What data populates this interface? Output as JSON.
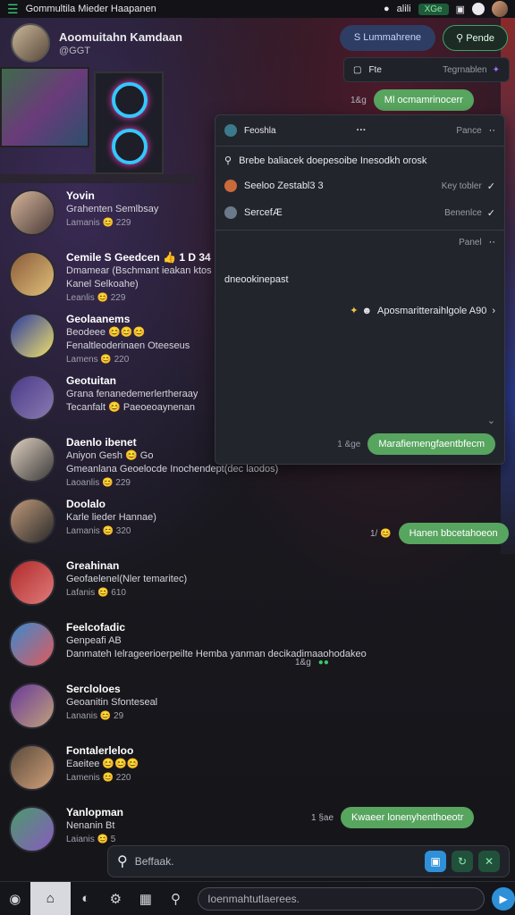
{
  "statusbar": {
    "title": "Gommultila Mieder Haapanen",
    "pill": "XGe",
    "label_a": "alili"
  },
  "header": {
    "community_name": "Aoomuitahn Kamdaan",
    "community_sub": "@GGT",
    "btn_primary": "S  Lummahrene",
    "btn_secondary": "Pende"
  },
  "top_chat": {
    "label": "Fte",
    "meta": "Tegrnablen",
    "bubble": "Ml ocmamrinocerr",
    "time": "1&g"
  },
  "panel": {
    "title": "Feoshla",
    "title_right": "Pance",
    "line1": "Brebe baliacek doepesoibe Inesodkh orosk",
    "item1": "Seeloo Zestabl3 3",
    "item1_right": "Key tobler",
    "item2": "SercefÆ",
    "item2_right": "Benenlce",
    "section_right": "Panel",
    "label": "dneookinepast",
    "link": "Aposmaritteraihlgole A90",
    "bubble": "Marafiemengfaentbfecm",
    "bubble_time": "1 &ge"
  },
  "contacts": [
    {
      "name": "Yovin",
      "line": "Grahenten Semlbsay",
      "time": "Lamanis  😊 229"
    },
    {
      "name": "Cemile S Geedcen  👍 1 D 34",
      "line": "Dmamear (Bschmant ieakan ktos",
      "line2": "Kanel Selkoahe)",
      "time": "Leanlis  😊 229"
    },
    {
      "name": "Geolaanems",
      "line": "Beodeee  😊😊😊",
      "line2": "Fenaltleoderinaen Oteeseus",
      "time": "Lamens  😊 220"
    },
    {
      "name": "Geotuitan",
      "line": "Grana  fenanedemerlertheraay",
      "line2": "Tecanfalt  😊 Paeoeoaynenan",
      "time": ""
    },
    {
      "name": "Daenlo ibenet",
      "line": "Aniyon Gesh  😊  Go",
      "line2": "Gmeanlana Geoelocde Inochendept(dec laodos)",
      "time": "Laoanlis  😊 229"
    },
    {
      "name": "Doolalo",
      "line": "Karle  lieder Hannae)",
      "time": "Lamanis  😊 320"
    },
    {
      "name": "Greahinan",
      "line": "Geofaelenel(Nler temaritec)",
      "time": "Lafanis  😊 610"
    },
    {
      "name": "Feelcofadic",
      "line": "Genpeafi  AB",
      "line2": "Danmateh Ielrageerioerpeilte Hemba yanman decikadimaaohodakeo",
      "time": ""
    },
    {
      "name": "Sercloloes",
      "line": "Geoanitin  Sfonteseal",
      "time": "Lananis  😊 29"
    },
    {
      "name": "Fontalerleloo",
      "line": "Eaeitee  😊😊😊",
      "time": "Lamenis  😊 220"
    },
    {
      "name": "Yanlopman",
      "line": "Nenanin  Bt",
      "time": "Laianis  😊 5"
    }
  ],
  "chat_items": [
    {
      "time": "1/ 😊",
      "bubble": "Hanen bbcetahoeon"
    },
    {
      "time": "1&g",
      "bubble": ""
    },
    {
      "time": "1 §ae",
      "bubble": "Kwaeer lonenyhenthoeotr"
    }
  ],
  "search": {
    "placeholder": "Beffaak."
  },
  "bottom": {
    "input_placeholder": "Ioenmahtutlaerees."
  },
  "colors": {
    "accent_green": "#57a55f",
    "accent_blue": "#2e90d9",
    "panel_bg": "#23252d"
  }
}
